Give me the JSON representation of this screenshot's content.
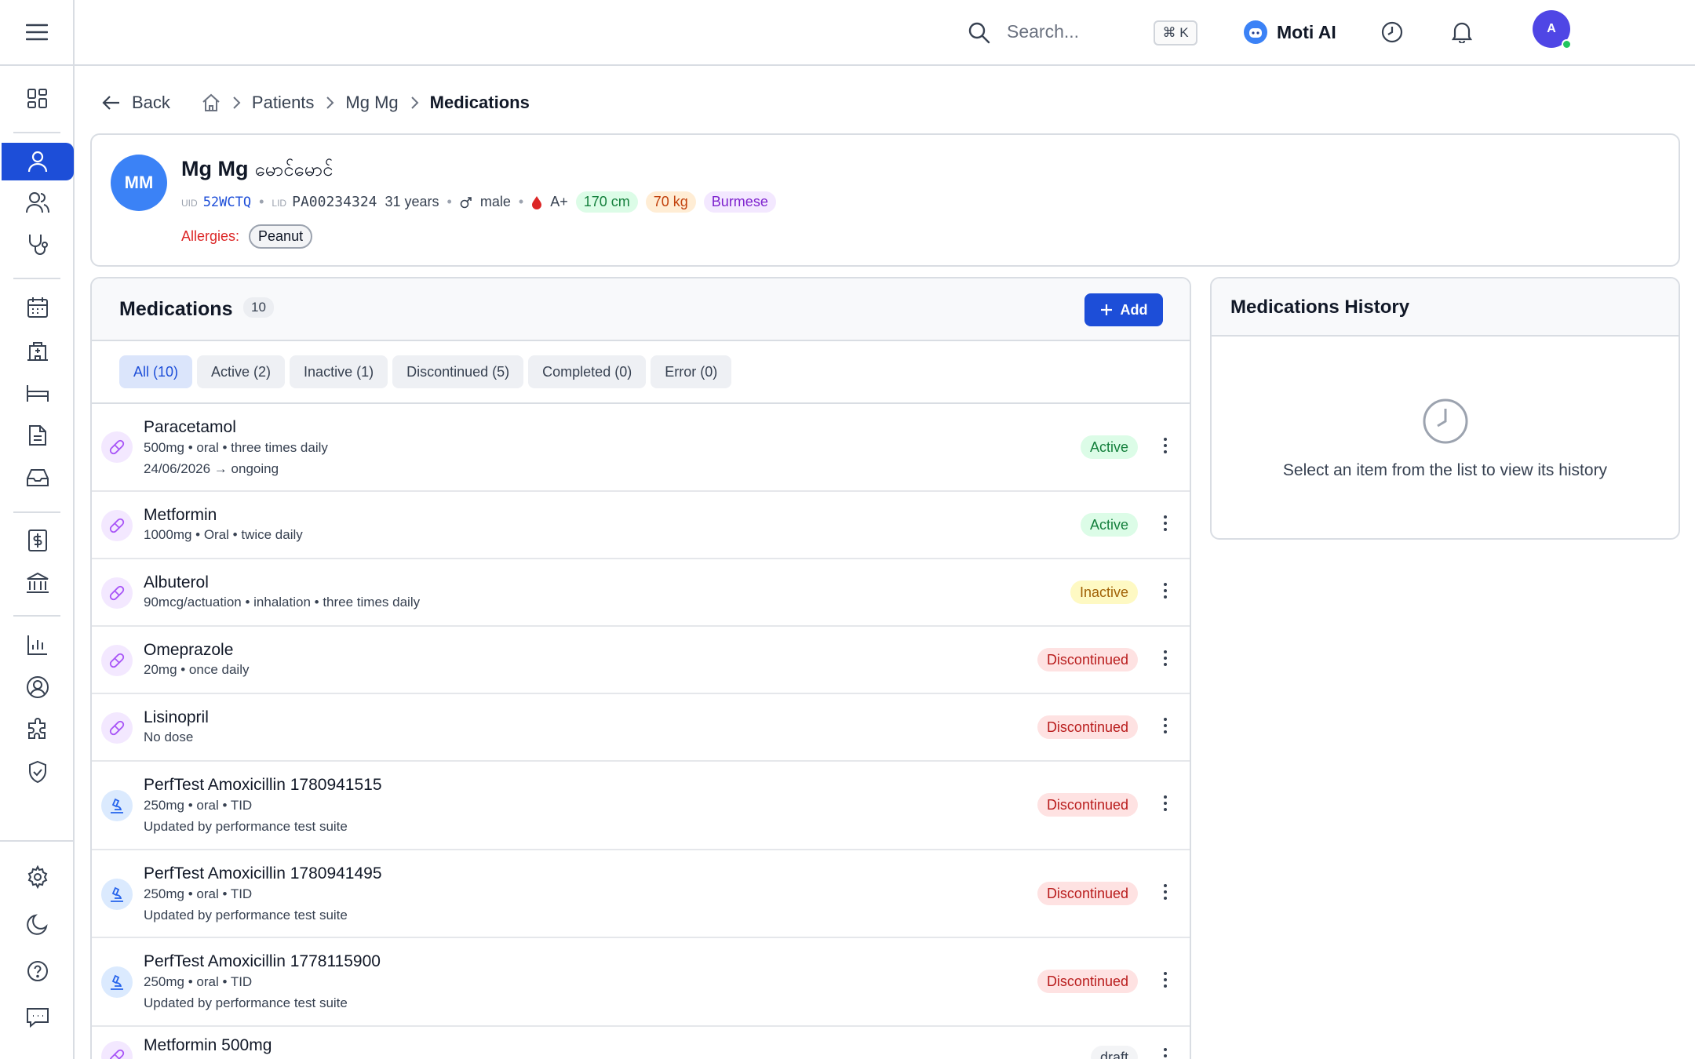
{
  "topbar": {
    "search_placeholder": "Search...",
    "shortcut": "⌘ K",
    "ai_label": "Moti AI",
    "user_initial": "A"
  },
  "breadcrumb": {
    "back": "Back",
    "items": [
      "Patients",
      "Mg Mg"
    ],
    "current": "Medications"
  },
  "patient": {
    "initials": "MM",
    "name": "Mg Mg",
    "name_alt": "မောင်မောင်",
    "uid_key": "UID",
    "uid": "52WCTQ",
    "lid_key": "LID",
    "lid": "PA00234324",
    "age": "31 years",
    "sex": "male",
    "blood": "A+",
    "height": "170 cm",
    "weight": "70 kg",
    "ethnicity": "Burmese",
    "allergies_label": "Allergies:",
    "allergies": [
      "Peanut"
    ]
  },
  "medications": {
    "title": "Medications",
    "count": "10",
    "add_label": "Add",
    "filters": [
      "All (10)",
      "Active (2)",
      "Inactive (1)",
      "Discontinued (5)",
      "Completed (0)",
      "Error (0)"
    ],
    "items": [
      {
        "name": "Paracetamol",
        "detail": "500mg • oral • three times daily",
        "extra": "24/06/2026 → ongoing",
        "status": "Active"
      },
      {
        "name": "Metformin",
        "detail": "1000mg • Oral • twice daily",
        "status": "Active"
      },
      {
        "name": "Albuterol",
        "detail": "90mcg/actuation • inhalation • three times daily",
        "status": "Inactive"
      },
      {
        "name": "Omeprazole",
        "detail": "20mg • once daily",
        "status": "Discontinued"
      },
      {
        "name": "Lisinopril",
        "detail": "No dose",
        "status": "Discontinued"
      },
      {
        "name": "PerfTest Amoxicillin 1780941515",
        "detail": "250mg • oral • TID",
        "extra": "Updated by performance test suite",
        "status": "Discontinued"
      },
      {
        "name": "PerfTest Amoxicillin 1780941495",
        "detail": "250mg • oral • TID",
        "extra": "Updated by performance test suite",
        "status": "Discontinued"
      },
      {
        "name": "PerfTest Amoxicillin 1778115900",
        "detail": "250mg • oral • TID",
        "extra": "Updated by performance test suite",
        "status": "Discontinued"
      },
      {
        "name": "Metformin 500mg",
        "status": "draft"
      }
    ]
  },
  "history": {
    "title": "Medications History",
    "empty": "Select an item from the list to view its history"
  }
}
